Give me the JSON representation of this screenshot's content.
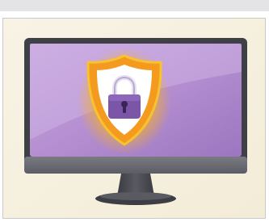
{
  "colors": {
    "page_background": "#ffffff",
    "top_bar": "#e4e4e6",
    "illustration_background": "#f7f2e2",
    "monitor_bezel": "#3f3f46",
    "monitor_chin": "#6f6f76",
    "monitor_stand": "#4b4b52",
    "screen_purple": "#b58fd1",
    "screen_highlight": "#d2b8e6",
    "shield_glow": "#f7b21a",
    "shield_outer": "#f49a1e",
    "shield_inner": "#ffffff",
    "padlock_body": "#7b56a8",
    "padlock_shackle": "#e8e2f0",
    "padlock_keyhole": "#3a2457"
  },
  "icons": {
    "monitor": "computer-monitor-icon",
    "shield": "security-shield-icon",
    "padlock": "padlock-icon"
  }
}
